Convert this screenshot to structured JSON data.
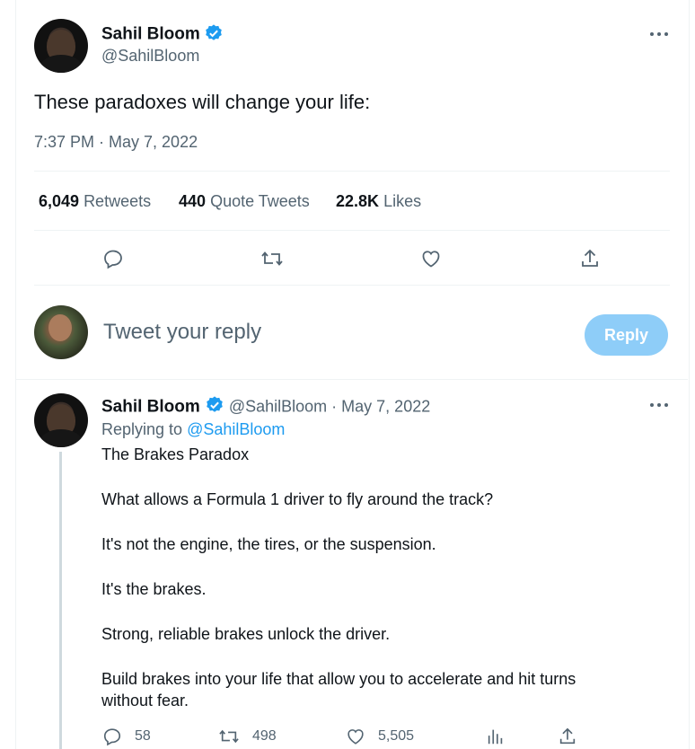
{
  "main_tweet": {
    "author_name": "Sahil Bloom",
    "author_handle": "@SahilBloom",
    "text": "These paradoxes will change your life:",
    "timestamp": "7:37 PM · May 7, 2022",
    "stats": {
      "retweets_count": "6,049",
      "retweets_label": "Retweets",
      "quotes_count": "440",
      "quotes_label": "Quote Tweets",
      "likes_count": "22.8K",
      "likes_label": "Likes"
    },
    "actions": [
      "reply-icon",
      "retweet-icon",
      "like-icon",
      "share-icon"
    ]
  },
  "reply_composer": {
    "placeholder": "Tweet your reply",
    "button_label": "Reply",
    "button_color": "#8ecdf8"
  },
  "reply_tweet": {
    "author_name": "Sahil Bloom",
    "author_handle": "@SahilBloom",
    "date": "· May 7, 2022",
    "replying_to_label": "Replying to",
    "replying_to_handle": "@SahilBloom",
    "paragraphs": [
      "The Brakes Paradox",
      "What allows a Formula 1 driver to fly around the track?",
      "It's not the engine, the tires, or the suspension.",
      "It's the brakes.",
      "Strong, reliable brakes unlock the driver.",
      "Build brakes into your life that allow you to accelerate and hit turns without fear."
    ],
    "reply_count": "58",
    "retweet_count": "498",
    "like_count": "5,505"
  },
  "colors": {
    "accent": "#1d9bf0",
    "text": "#0f1419",
    "muted": "#536471",
    "divider": "#eff3f4"
  }
}
